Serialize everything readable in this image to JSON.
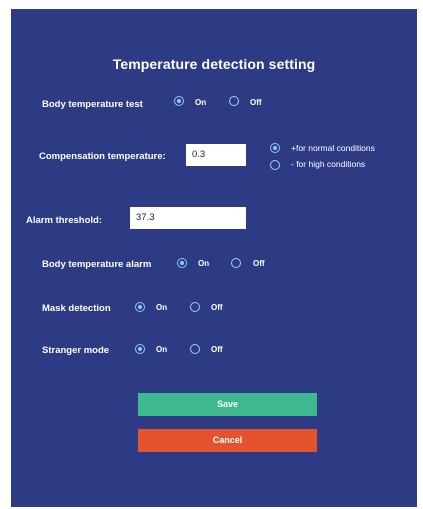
{
  "title": "Temperature detection setting",
  "body_test": {
    "label": "Body temperature test",
    "on": "On",
    "off": "Off",
    "selected": "on"
  },
  "compensation": {
    "label": "Compensation temperature:",
    "value": "0.3",
    "opt_normal": "+for normal conditions",
    "opt_high": "- for high conditions",
    "selected": "normal"
  },
  "alarm_threshold": {
    "label": "Alarm threshold:",
    "value": "37.3"
  },
  "body_alarm": {
    "label": "Body temperature alarm",
    "on": "On",
    "off": "Off",
    "selected": "on"
  },
  "mask": {
    "label": "Mask detection",
    "on": "On",
    "off": "Off",
    "selected": "on"
  },
  "stranger": {
    "label": "Stranger mode",
    "on": "On",
    "off": "Off",
    "selected": "on"
  },
  "buttons": {
    "save": "Save",
    "cancel": "Cancel"
  },
  "colors": {
    "panel": "#2d3a84",
    "save": "#3db88f",
    "cancel": "#e5532e",
    "radio": "#8fc8ff"
  }
}
